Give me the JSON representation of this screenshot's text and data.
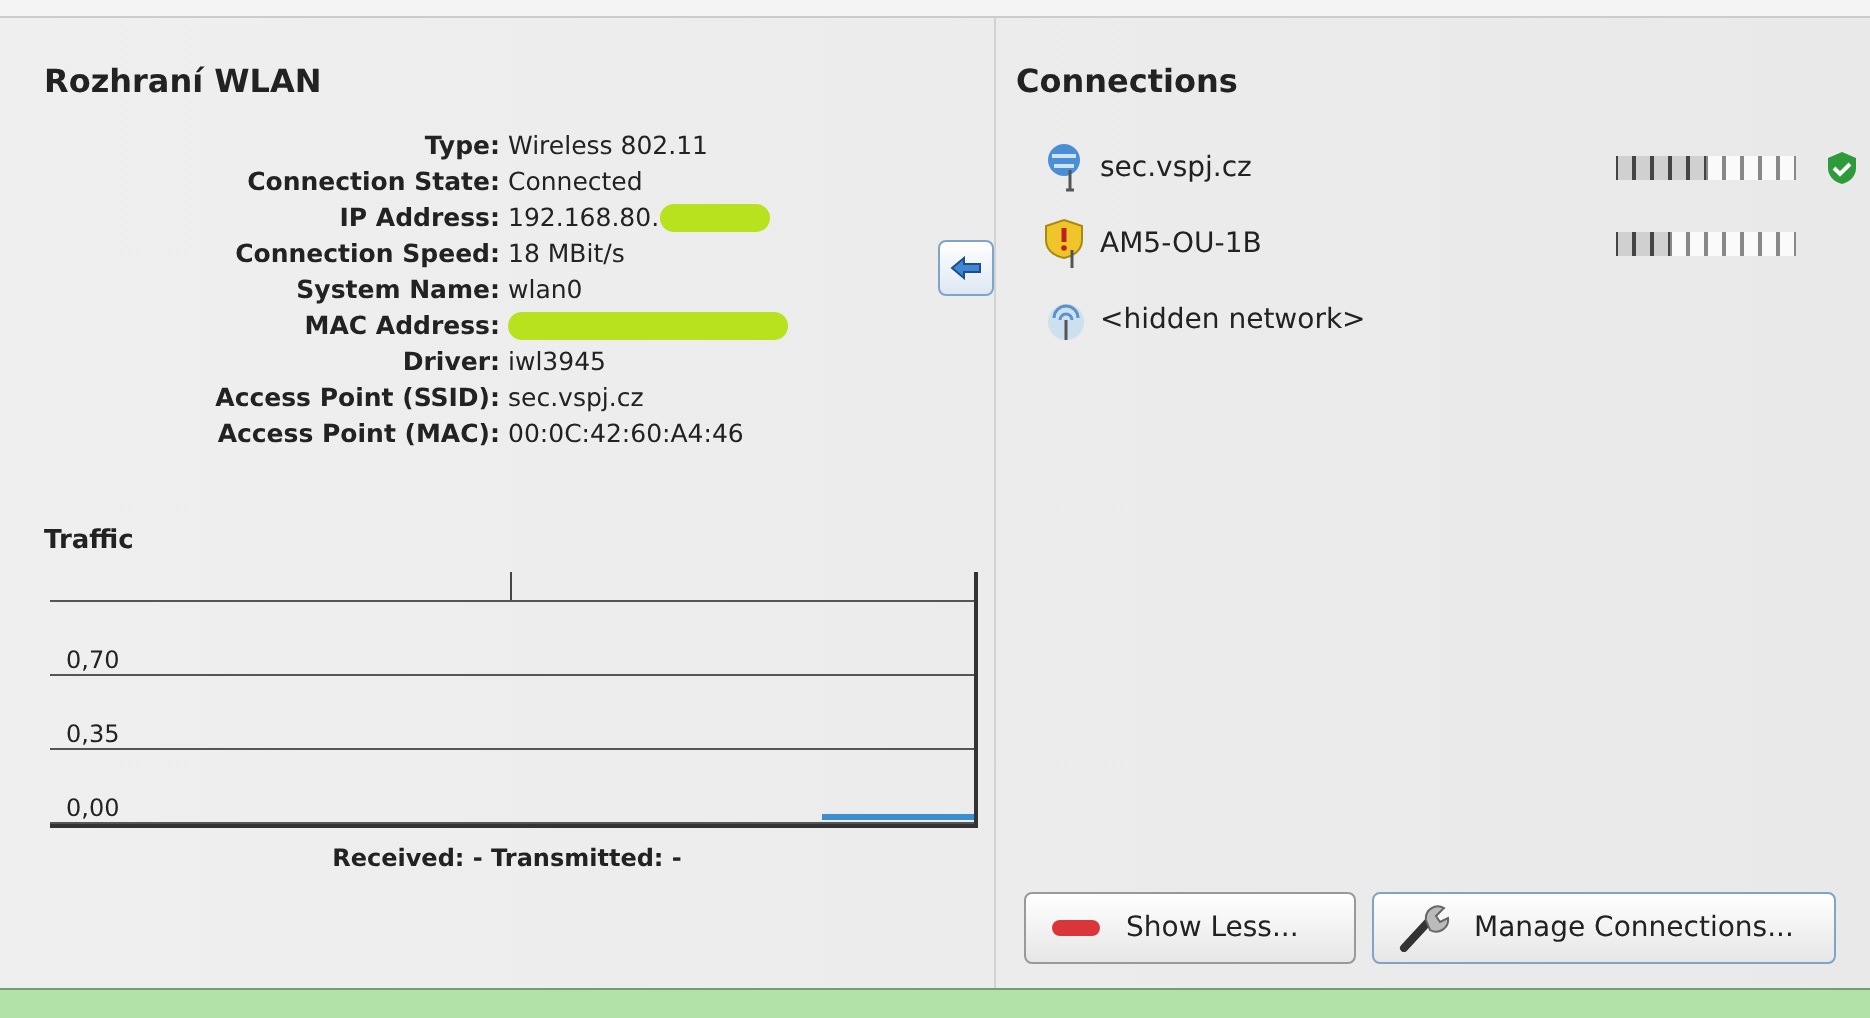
{
  "interface": {
    "title": "Rozhraní WLAN",
    "details": [
      {
        "label": "Type:",
        "value": "Wireless 802.11",
        "redacted": false
      },
      {
        "label": "Connection State:",
        "value": "Connected",
        "redacted": false
      },
      {
        "label": "IP Address:",
        "value": "192.168.80.",
        "redacted": true
      },
      {
        "label": "Connection Speed:",
        "value": "18 MBit/s",
        "redacted": false
      },
      {
        "label": "System Name:",
        "value": "wlan0",
        "redacted": false
      },
      {
        "label": "MAC Address:",
        "redacted": true
      },
      {
        "label": "Driver:",
        "value": "iwl3945",
        "redacted": false
      },
      {
        "label": "Access Point (SSID):",
        "value": "sec.vspj.cz",
        "redacted": false
      },
      {
        "label": "Access Point (MAC):",
        "value": "00:0C:42:60:A4:46",
        "redacted": false
      }
    ]
  },
  "traffic": {
    "title": "Traffic",
    "y_labels": [
      "0,70",
      "0,35",
      "0,00"
    ],
    "summary": "Received: - Transmitted: -"
  },
  "connections": {
    "title": "Connections",
    "items": [
      {
        "name": "sec.vspj.cz",
        "kind": "connected",
        "level": 0.5,
        "secured": true
      },
      {
        "name": "AM5-OU-1B",
        "kind": "warning",
        "level": 0.3,
        "secured": false
      },
      {
        "name": "<hidden network>",
        "kind": "hidden",
        "secured": false
      }
    ]
  },
  "buttons": [
    {
      "label": "Show Less...",
      "kind": "less"
    },
    {
      "label": "Manage Connections...",
      "kind": "manage"
    }
  ]
}
